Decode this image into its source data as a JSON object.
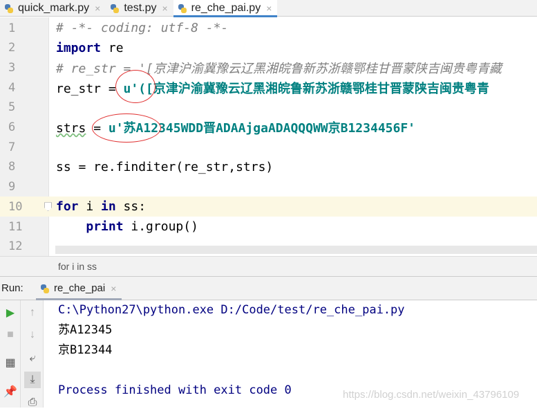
{
  "tabs": [
    {
      "label": "quick_mark.py",
      "active": false
    },
    {
      "label": "test.py",
      "active": false
    },
    {
      "label": "re_che_pai.py",
      "active": true
    }
  ],
  "tab_close_glyph": "×",
  "editor": {
    "current_line": 10,
    "lines": [
      {
        "num": "1",
        "tokens": [
          {
            "t": "# -*- coding: utf-8 -*-",
            "c": "cm"
          }
        ]
      },
      {
        "num": "2",
        "tokens": [
          {
            "t": "import",
            "c": "kw"
          },
          {
            "t": " re",
            "c": ""
          }
        ]
      },
      {
        "num": "3",
        "tokens": [
          {
            "t": "# re_str = '[京津沪渝冀豫云辽黑湘皖鲁新苏浙赣鄂桂甘晋蒙陕吉闽贵粤青藏",
            "c": "cm"
          }
        ]
      },
      {
        "num": "4",
        "tokens": [
          {
            "t": "re_str = ",
            "c": ""
          },
          {
            "t": "u'([京津沪渝冀豫云辽黑湘皖鲁新苏浙赣鄂桂甘晋蒙陕吉闽贵粤青",
            "c": "st"
          }
        ]
      },
      {
        "num": "5",
        "tokens": []
      },
      {
        "num": "6",
        "tokens": [
          {
            "t": "strs",
            "c": "wavy"
          },
          {
            "t": " = ",
            "c": ""
          },
          {
            "t": "u'苏A12345WDD晋ADAAjgaADAQQQWW京B1234456F'",
            "c": "st"
          }
        ]
      },
      {
        "num": "7",
        "tokens": []
      },
      {
        "num": "8",
        "tokens": [
          {
            "t": "ss = re.finditer(re_str,strs)",
            "c": ""
          }
        ]
      },
      {
        "num": "9",
        "tokens": []
      },
      {
        "num": "10",
        "tokens": [
          {
            "t": "for",
            "c": "kw"
          },
          {
            "t": " i ",
            "c": ""
          },
          {
            "t": "in",
            "c": "kw"
          },
          {
            "t": " ss:",
            "c": ""
          }
        ]
      },
      {
        "num": "11",
        "tokens": [
          {
            "t": "    ",
            "c": ""
          },
          {
            "t": "print",
            "c": "kw"
          },
          {
            "t": " i.group()",
            "c": ""
          }
        ]
      },
      {
        "num": "12",
        "tokens": []
      }
    ]
  },
  "breadcrumb": "for i in ss",
  "run": {
    "label": "Run:",
    "tab": "re_che_pai",
    "output": [
      {
        "text": "C:\\Python27\\python.exe D:/Code/test/re_che_pai.py",
        "type": "sys"
      },
      {
        "text": "苏A12345",
        "type": "out"
      },
      {
        "text": "京B12344",
        "type": "out"
      },
      {
        "text": "",
        "type": "out"
      },
      {
        "text": "Process finished with exit code 0",
        "type": "sys"
      }
    ]
  },
  "watermark": "https://blog.csdn.net/weixin_43796109",
  "colors": {
    "keyword": "#000080",
    "string": "#008080",
    "comment": "#808080",
    "annotation": "#e03030",
    "current_line": "#fcf8e3",
    "tab_underline": "#4083c9"
  }
}
